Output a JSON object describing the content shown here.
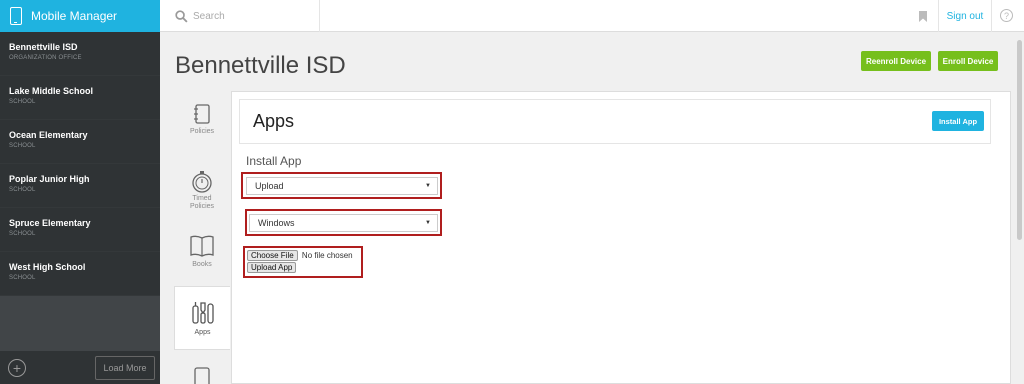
{
  "app": {
    "title": "Mobile Manager"
  },
  "header": {
    "search_placeholder": "Search",
    "signout_label": "Sign out",
    "help_glyph": "?"
  },
  "sidebar": {
    "items": [
      {
        "name": "Bennettville ISD",
        "type": "ORGANIZATION OFFICE"
      },
      {
        "name": "Lake Middle School",
        "type": "SCHOOL"
      },
      {
        "name": "Ocean Elementary",
        "type": "SCHOOL"
      },
      {
        "name": "Poplar Junior High",
        "type": "SCHOOL"
      },
      {
        "name": "Spruce Elementary",
        "type": "SCHOOL"
      },
      {
        "name": "West High School",
        "type": "SCHOOL"
      }
    ],
    "add_glyph": "+",
    "load_more_label": "Load More"
  },
  "main": {
    "page_title": "Bennettville ISD",
    "reenroll_label": "Reenroll Device",
    "enroll_label": "Enroll Device",
    "tabs": [
      {
        "label": "Policies",
        "icon": "notebook-icon"
      },
      {
        "label": "Timed Policies",
        "icon": "timer-icon"
      },
      {
        "label": "Books",
        "icon": "book-icon"
      },
      {
        "label": "Apps",
        "icon": "apps-icon"
      }
    ],
    "panel_title": "Apps",
    "install_button_label": "Install App",
    "section_label": "Install App",
    "upload_select_value": "Upload",
    "platform_select_value": "Windows",
    "choose_file_label": "Choose File",
    "no_file_text": "No file chosen",
    "upload_app_label": "Upload App"
  },
  "colors": {
    "brand": "#1fb3e0",
    "sidebar_bg": "#414548",
    "green_button": "#76bf1c",
    "highlight": "#b01e1e"
  }
}
